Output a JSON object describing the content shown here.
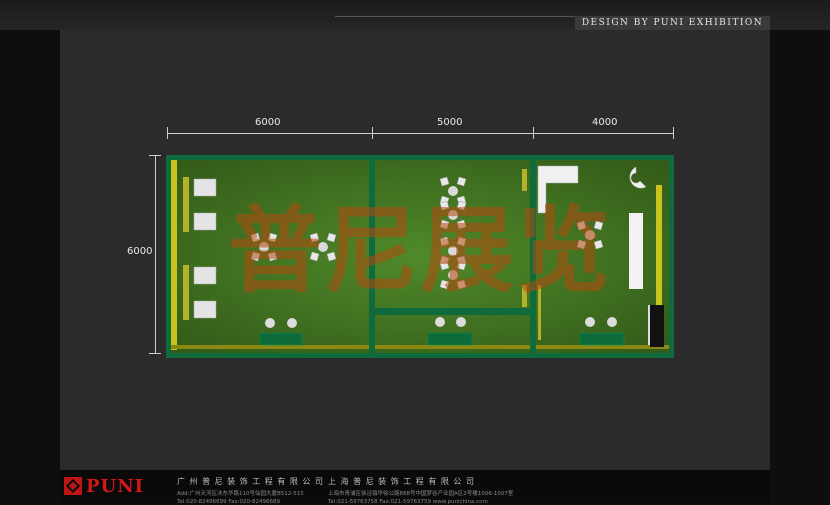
{
  "header": {
    "brand_strip": "Design by PUNI Exhibition"
  },
  "dimensions": {
    "widths": [
      "6000",
      "5000",
      "4000"
    ],
    "height": "6000"
  },
  "watermark": "普尼展览",
  "colors": {
    "background": "#2b2b2b",
    "wall_green": "#0f6b3c",
    "carpet_green": "#3f6f22",
    "accent_yellow": "#c9c41e",
    "brand_red": "#d21818"
  },
  "footer": {
    "logo_text": "PUNI",
    "company_gz": {
      "name": "广 州 普 尼 装 饰 工 程 有 限 公 司",
      "address": "Add:广州天河区沐东华路110号仙园大厦B512-515",
      "phone": "Tel:020-82496699    Fax:020-82496689"
    },
    "company_sh": {
      "name": "上 海 普 尼 装 饰 工 程 有 限 公 司",
      "address": "上海市青浦区徐泾镇华徐公路888号中国梦谷产业园A区2号楼1006-1007室",
      "phone": "Tel:021-59763758    Fax:021-59763759    www.punichina.com"
    }
  }
}
